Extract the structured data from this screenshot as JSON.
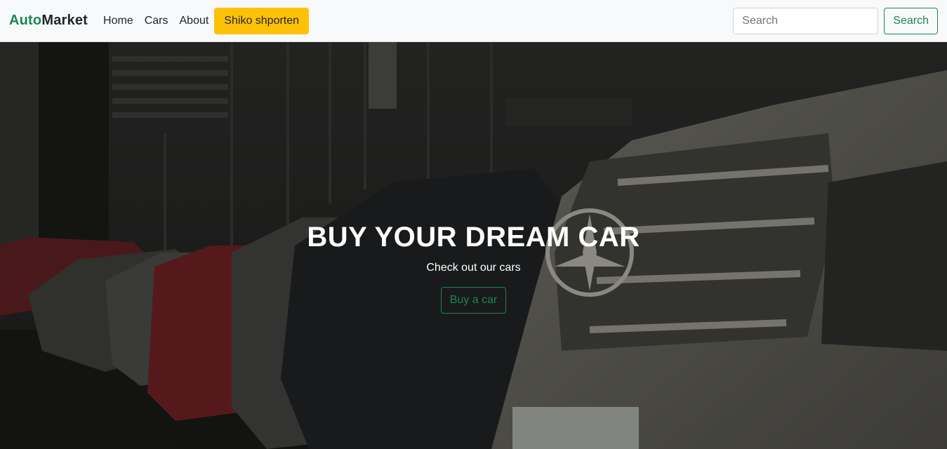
{
  "navbar": {
    "brand_accent": "Auto",
    "brand_rest": "Market",
    "links": [
      {
        "label": "Home"
      },
      {
        "label": "Cars"
      },
      {
        "label": "About"
      }
    ],
    "cart_label": "Shiko shporten",
    "search": {
      "placeholder": "Search",
      "button_label": "Search"
    }
  },
  "hero": {
    "title": "BUY YOUR DREAM CAR",
    "subtitle": "Check out our cars",
    "button_label": "Buy a car"
  },
  "colors": {
    "accent_green": "#198754",
    "cart_yellow": "#ffc107",
    "navbar_bg": "#f8f9fa"
  }
}
